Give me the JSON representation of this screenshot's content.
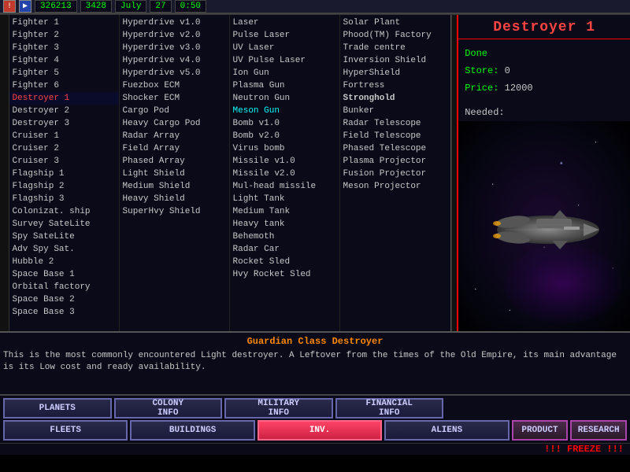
{
  "topbar": {
    "btn1": "!",
    "btn2": ">",
    "credits": "326213",
    "income": "3428",
    "month": "July",
    "day": "27",
    "time": "0:50"
  },
  "ship": {
    "title": "Destroyer 1",
    "status": "Done",
    "store_label": "Store:",
    "store_value": "0",
    "price_label": "Price:",
    "price_value": "12000",
    "needed_label": "Needed:",
    "class_title": "Guardian Class Destroyer",
    "description": "This is the most commonly encountered Light destroyer. A Leftover from the times of the Old Empire, its main advantage is its Low cost and ready availability."
  },
  "col1": {
    "items": [
      {
        "label": "Fighter 1",
        "selected": false
      },
      {
        "label": "Fighter 2",
        "selected": false
      },
      {
        "label": "Fighter 3",
        "selected": false
      },
      {
        "label": "Fighter 4",
        "selected": false
      },
      {
        "label": "Fighter 5",
        "selected": false
      },
      {
        "label": "Fighter 6",
        "selected": false
      },
      {
        "label": "Destroyer 1",
        "selected": true
      },
      {
        "label": "Destroyer 2",
        "selected": false
      },
      {
        "label": "Destroyer 3",
        "selected": false
      },
      {
        "label": "Cruiser 1",
        "selected": false
      },
      {
        "label": "Cruiser 2",
        "selected": false
      },
      {
        "label": "Cruiser 3",
        "selected": false
      },
      {
        "label": "Flagship 1",
        "selected": false
      },
      {
        "label": "Flagship 2",
        "selected": false
      },
      {
        "label": "Flagship 3",
        "selected": false
      },
      {
        "label": "Colonizat. ship",
        "selected": false
      },
      {
        "label": "Survey SateLite",
        "selected": false
      },
      {
        "label": "Spy SateLite",
        "selected": false
      },
      {
        "label": "Adv Spy Sat.",
        "selected": false
      },
      {
        "label": "Hubble 2",
        "selected": false
      },
      {
        "label": "Space Base 1",
        "selected": false
      },
      {
        "label": "Orbital factory",
        "selected": false
      },
      {
        "label": "Space Base 2",
        "selected": false
      },
      {
        "label": "Space Base 3",
        "selected": false
      }
    ]
  },
  "col2": {
    "items": [
      {
        "label": "Hyperdrive v1.0"
      },
      {
        "label": "Hyperdrive v2.0"
      },
      {
        "label": "Hyperdrive v3.0"
      },
      {
        "label": "Hyperdrive v4.0"
      },
      {
        "label": "Hyperdrive v5.0"
      },
      {
        "label": "Fuezbox ECM"
      },
      {
        "label": "Shocker ECM"
      },
      {
        "label": "Cargo Pod"
      },
      {
        "label": "Heavy Cargo Pod"
      },
      {
        "label": "Radar Array"
      },
      {
        "label": "Field Array"
      },
      {
        "label": "Phased Array"
      },
      {
        "label": "Light Shield"
      },
      {
        "label": "Medium Shield"
      },
      {
        "label": "Heavy Shield"
      },
      {
        "label": "SuperHvy Shield"
      }
    ]
  },
  "col3": {
    "items": [
      {
        "label": "Laser"
      },
      {
        "label": "Pulse Laser"
      },
      {
        "label": "UV Laser"
      },
      {
        "label": "UV Pulse Laser"
      },
      {
        "label": "Ion Gun"
      },
      {
        "label": "Plasma Gun"
      },
      {
        "label": "Neutron Gun"
      },
      {
        "label": "Meson Gun",
        "cyan": true
      },
      {
        "label": "Bomb v1.0"
      },
      {
        "label": "Bomb v2.0"
      },
      {
        "label": "Virus bomb"
      },
      {
        "label": "Missile v1.0"
      },
      {
        "label": "Missile v2.0"
      },
      {
        "label": "Mul-head missile"
      },
      {
        "label": "Light Tank"
      },
      {
        "label": "Medium Tank"
      },
      {
        "label": "Heavy tank"
      },
      {
        "label": "Behemoth"
      },
      {
        "label": "Radar Car"
      },
      {
        "label": "Rocket Sled"
      },
      {
        "label": "Hvy Rocket Sled"
      }
    ]
  },
  "col4": {
    "items": [
      {
        "label": "Solar Plant"
      },
      {
        "label": "Phood(TM) Factory"
      },
      {
        "label": "Trade centre"
      },
      {
        "label": "Inversion Shield"
      },
      {
        "label": "HyperShield"
      },
      {
        "label": "Fortress"
      },
      {
        "label": "Stronghold",
        "bold": true
      },
      {
        "label": "Bunker"
      },
      {
        "label": "Radar Telescope"
      },
      {
        "label": "Field Telescope"
      },
      {
        "label": "Phased Telescope"
      },
      {
        "label": "Plasma Projector"
      },
      {
        "label": "Fusion Projector"
      },
      {
        "label": "Meson Projector"
      }
    ]
  },
  "nav": {
    "row1": [
      {
        "label": "PLANETS",
        "active": false
      },
      {
        "label": "COLONY\nINFO",
        "active": false
      },
      {
        "label": "MILITARY\nINFO",
        "active": false
      },
      {
        "label": "FINANCIAL\nINFO",
        "active": false
      }
    ],
    "row2_left": [
      {
        "label": "FLEETS",
        "active": false
      },
      {
        "label": "BUILDINGS",
        "active": false
      },
      {
        "label": "INV.",
        "active": true
      },
      {
        "label": "ALIENS",
        "active": false
      }
    ],
    "row2_right": [
      {
        "label": "PRODUCT",
        "active": false
      },
      {
        "label": "RESEARCH",
        "active": false
      }
    ]
  },
  "freeze": "!!! FREEZE !!!"
}
